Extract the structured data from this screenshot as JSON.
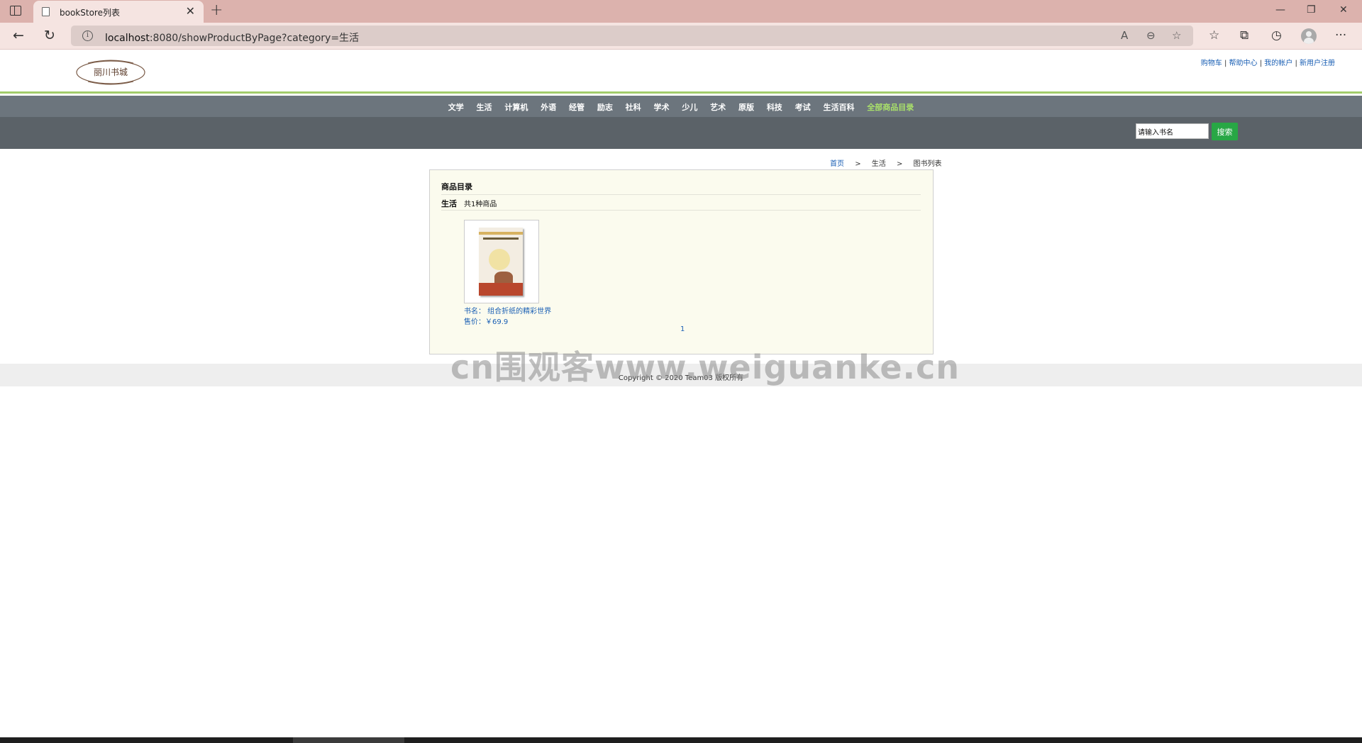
{
  "browser": {
    "tab_title": "bookStore列表",
    "url_host": "localhost",
    "url_rest": ":8080/showProductByPage?category=生活",
    "new_tab_icon": "plus-icon",
    "window_controls": [
      "minimize",
      "restore",
      "close"
    ]
  },
  "header": {
    "logo_text": "丽川书城",
    "links": [
      "购物车",
      "帮助中心",
      "我的帐户",
      "新用户注册"
    ]
  },
  "nav": {
    "items": [
      "文学",
      "生活",
      "计算机",
      "外语",
      "经管",
      "励志",
      "社科",
      "学术",
      "少儿",
      "艺术",
      "原版",
      "科技",
      "考试",
      "生活百科"
    ],
    "all_label": "全部商品目录"
  },
  "search": {
    "value": "请输入书名",
    "button_label": "搜索"
  },
  "breadcrumb": {
    "home": "首页",
    "sep": ">",
    "category": "生活",
    "current": "图书列表"
  },
  "catalog": {
    "title": "商品目录",
    "category": "生活",
    "count_text": "共1种商品",
    "products": [
      {
        "name": "书名： 组合折纸的精彩世界",
        "price": "售价：￥69.9"
      }
    ],
    "page": "1"
  },
  "footer": {
    "copyright": "Copyright © 2020 Team03 版权所有"
  },
  "watermark": "cn围观客www.weiguanke.cn"
}
